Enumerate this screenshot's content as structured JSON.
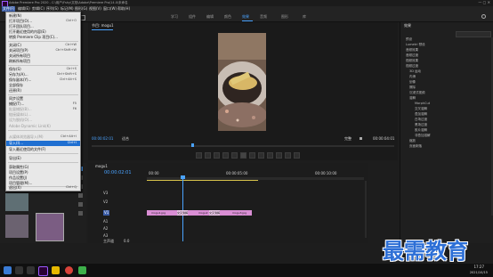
{
  "window": {
    "title": "Adobe Premiere Pro 2020 - C:\\用户\\Fshy\\文档\\Adobe\\Premiere Pro\\14.0\\未命名"
  },
  "menubar": {
    "items": [
      "文件(F)",
      "编辑(E)",
      "剪辑(C)",
      "序列(S)",
      "标记(M)",
      "图形(G)",
      "视图(V)",
      "窗口(W)",
      "帮助(H)"
    ]
  },
  "workspaces": [
    "学习",
    "组件",
    "编辑",
    "颜色",
    "效果",
    "音频",
    "图形",
    "库"
  ],
  "active_workspace": "效果",
  "file_menu": {
    "items": [
      {
        "label": "新建(N)",
        "shortcut": ""
      },
      {
        "label": "打开项目(O)...",
        "shortcut": "Ctrl+O"
      },
      {
        "label": "打开团队项目...",
        "shortcut": ""
      },
      {
        "label": "打开最近使用的内容(E)",
        "shortcut": ""
      },
      {
        "label": "转换 Premiere Clip 项目(C)...",
        "shortcut": ""
      },
      {
        "label": "关闭(C)",
        "shortcut": "Ctrl+W"
      },
      {
        "label": "关闭项目(P)",
        "shortcut": "Ctrl+Shift+W"
      },
      {
        "label": "关闭所有项目",
        "shortcut": ""
      },
      {
        "label": "刷新所有项目",
        "shortcut": ""
      },
      {
        "label": "保存(S)",
        "shortcut": "Ctrl+S"
      },
      {
        "label": "另存为(A)...",
        "shortcut": "Ctrl+Shift+S"
      },
      {
        "label": "保存副本(Y)...",
        "shortcut": "Ctrl+Alt+S"
      },
      {
        "label": "全部保存",
        "shortcut": ""
      },
      {
        "label": "还原(R)",
        "shortcut": ""
      },
      {
        "label": "同步设置",
        "shortcut": ""
      },
      {
        "label": "捕捉(T)...",
        "shortcut": "F5"
      },
      {
        "label": "批量捕捉(B)...",
        "shortcut": "F6"
      },
      {
        "label": "链接媒体(L)...",
        "shortcut": ""
      },
      {
        "label": "设为脱机(O)...",
        "shortcut": ""
      },
      {
        "label": "Adobe Dynamic Link(K)",
        "shortcut": ""
      },
      {
        "label": "从媒体浏览器导入(M)",
        "shortcut": "Ctrl+Alt+I"
      },
      {
        "label": "导入(I)...",
        "shortcut": "Ctrl+I"
      },
      {
        "label": "导入最近使用的文件(F)",
        "shortcut": ""
      },
      {
        "label": "导出(E)",
        "shortcut": ""
      },
      {
        "label": "获取属性(G)",
        "shortcut": ""
      },
      {
        "label": "项目设置(P)",
        "shortcut": ""
      },
      {
        "label": "作品设置(J)",
        "shortcut": ""
      },
      {
        "label": "项目管理(M)...",
        "shortcut": ""
      },
      {
        "label": "退出(X)",
        "shortcut": "Ctrl+Q"
      }
    ],
    "highlighted": "导入(I)..."
  },
  "program_monitor": {
    "title": "节目: mogu1",
    "timecode_left": "00:00:02:01",
    "fit": "适合",
    "quality": "完整",
    "timecode_right": "00:00:04:01"
  },
  "timeline": {
    "tab": "mogu1",
    "timecode": "00:00:02:01",
    "ruler": [
      "00:00",
      "00:00:05:00",
      "00:00:10:00"
    ],
    "tracks": [
      "V3",
      "V2",
      "V1",
      "A1",
      "A2",
      "A3"
    ],
    "master_label": "主声道",
    "master_value": "0.0",
    "clips": [
      "mogu1.jpg",
      "交叉溶解",
      "mogu2",
      "交叉溶解",
      "mogu3.jpg"
    ]
  },
  "effects_panel": {
    "title": "效果",
    "items": [
      "预设",
      "Lumetri 预设",
      "音频效果",
      "音频过渡",
      "视频效果",
      "视频过渡",
      "3D 运动",
      "内滑",
      "划像",
      "擦除",
      "沉浸式视频",
      "溶解",
      "MorphCut",
      "交叉溶解",
      "叠加溶解",
      "白场过渡",
      "黑场过渡",
      "胶片溶解",
      "非叠加溶解",
      "缩放",
      "页面剥落"
    ]
  },
  "watermark": "最需教育",
  "taskbar": {
    "time": "17:27",
    "date": "2021/10/15"
  },
  "colors": {
    "clip": "#d98ed4",
    "accent": "#2d8ceb",
    "playhead": "#4aa3ff",
    "menu_highlight": "#1f6fd1"
  }
}
